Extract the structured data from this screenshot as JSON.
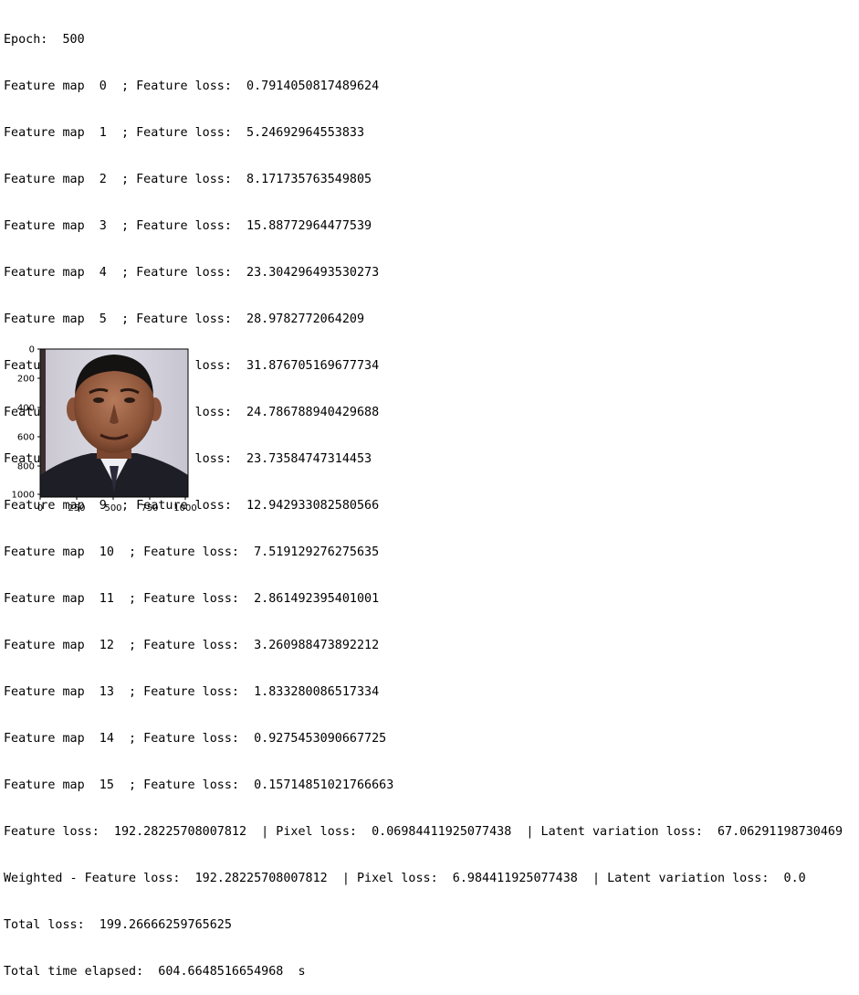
{
  "output": {
    "lines": [
      "Epoch:  500",
      "Feature map  0  ; Feature loss:  0.7914050817489624",
      "Feature map  1  ; Feature loss:  5.24692964553833",
      "Feature map  2  ; Feature loss:  8.171735763549805",
      "Feature map  3  ; Feature loss:  15.88772964477539",
      "Feature map  4  ; Feature loss:  23.304296493530273",
      "Feature map  5  ; Feature loss:  28.9782772064209",
      "Feature map  6  ; Feature loss:  31.876705169677734",
      "Feature map  7  ; Feature loss:  24.786788940429688",
      "Feature map  8  ; Feature loss:  23.73584747314453",
      "Feature map  9  ; Feature loss:  12.942933082580566",
      "Feature map  10  ; Feature loss:  7.519129276275635",
      "Feature map  11  ; Feature loss:  2.861492395401001",
      "Feature map  12  ; Feature loss:  3.260988473892212",
      "Feature map  13  ; Feature loss:  1.833280086517334",
      "Feature map  14  ; Feature loss:  0.9275453090667725",
      "Feature map  15  ; Feature loss:  0.15714851021766663",
      "Feature loss:  192.28225708007812  | Pixel loss:  0.06984411925077438  | Latent variation loss:  67.06291198730469",
      "Weighted - Feature loss:  192.28225708007812  | Pixel loss:  6.984411925077438  | Latent variation loss:  0.0",
      "Total loss:  199.26666259765625",
      "Total time elapsed:  604.6648516654968  s"
    ]
  },
  "figure": {
    "image_subject": "portrait-photo",
    "x_ticks": [
      "0",
      "250",
      "500",
      "750",
      "1000"
    ],
    "y_ticks": [
      "0",
      "200",
      "400",
      "600",
      "800",
      "1000"
    ]
  }
}
